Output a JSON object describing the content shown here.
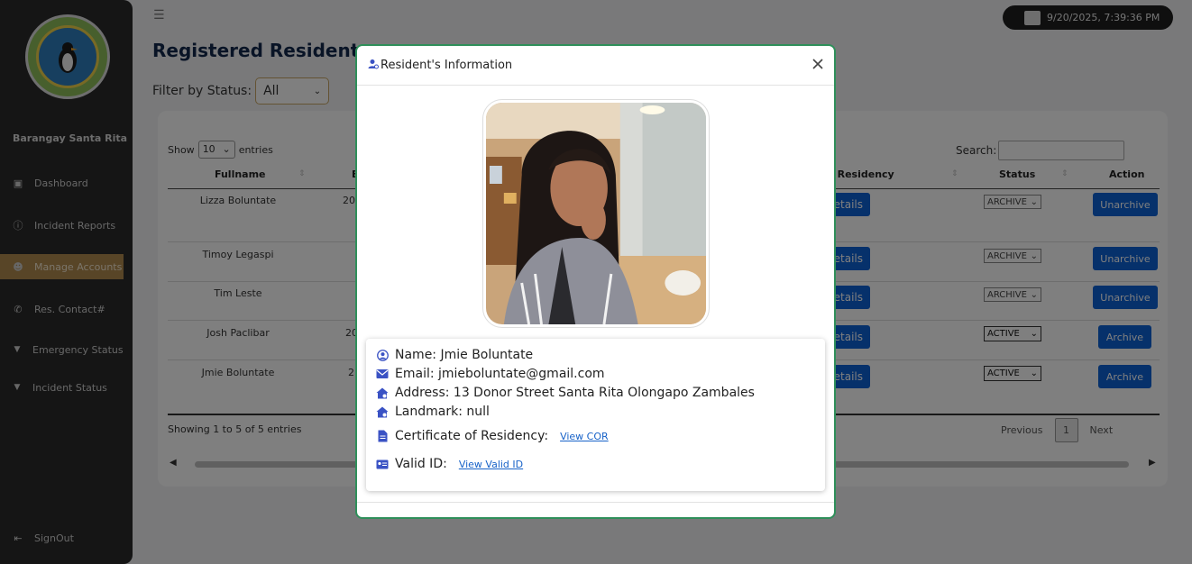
{
  "sidebar": {
    "brand": "Barangay Santa Rita",
    "items": [
      {
        "label": "Dashboard"
      },
      {
        "label": "Incident Reports"
      },
      {
        "label": "Manage Accounts"
      },
      {
        "label": "Res. Contact#"
      },
      {
        "label": "Emergency Status"
      },
      {
        "label": "Incident Status"
      }
    ],
    "signout": "SignOut"
  },
  "header": {
    "datetime": "9/20/2025, 7:39:36 PM"
  },
  "main": {
    "title": "Registered Residents",
    "filter_label": "Filter by Status:",
    "filter_value": "All",
    "table": {
      "show_label": "Show",
      "entries_value": "10",
      "entries_label": "entries",
      "search_label": "Search:",
      "columns": [
        "Fullname",
        "E",
        "f Residency",
        "Status",
        "Action"
      ],
      "rows": [
        {
          "name": "Lizza Boluntate",
          "col2": "20",
          "details": "etails",
          "status": "ARCHIVE",
          "action": "Unarchive"
        },
        {
          "name": "Timoy Legaspi",
          "col2": "",
          "details": "etails",
          "status": "ARCHIVE",
          "action": "Unarchive"
        },
        {
          "name": "Tim Leste",
          "col2": "",
          "details": "etails",
          "status": "ARCHIVE",
          "action": "Unarchive"
        },
        {
          "name": "Josh Paclibar",
          "col2": "20",
          "details": "etails",
          "status": "ACTIVE",
          "action": "Archive"
        },
        {
          "name": "Jmie Boluntate",
          "col2": "2",
          "details": "etails",
          "status": "ACTIVE",
          "action": "Archive"
        }
      ],
      "info": "Showing 1 to 5 of 5 entries",
      "prev": "Previous",
      "page": "1",
      "next": "Next"
    }
  },
  "modal": {
    "title": "Resident's Information",
    "name": "Name: Jmie Boluntate",
    "email": "Email: jmieboluntate@gmail.com",
    "address": "Address: 13 Donor Street Santa Rita Olongapo Zambales",
    "landmark": "Landmark: null",
    "cor_label": "Certificate of Residency:",
    "cor_link": "View COR",
    "id_label": "Valid ID:",
    "id_link": "View Valid ID"
  },
  "colors": {
    "sidebar_bg": "#2b2b2b",
    "active_nav": "#b08a4e",
    "primary_button": "#0d62d6",
    "modal_border": "#2f8f5a",
    "title_navy": "#13284d"
  }
}
